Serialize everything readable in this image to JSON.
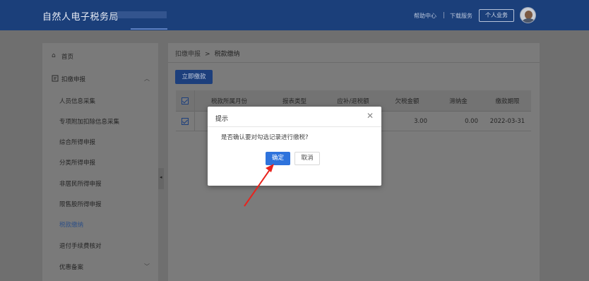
{
  "header": {
    "brand": "自然人电子税务局",
    "links": [
      "帮助中心",
      "下载服务"
    ],
    "personal_button": "个人业务"
  },
  "sidebar": {
    "items": [
      {
        "label": "首页",
        "icon": "home-icon"
      },
      {
        "label": "扣缴申报",
        "icon": "report-icon",
        "expanded": true
      },
      {
        "label": "人员信息采集"
      },
      {
        "label": "专项附加扣除信息采集"
      },
      {
        "label": "综合所得申报"
      },
      {
        "label": "分类所得申报"
      },
      {
        "label": "非居民所得申报"
      },
      {
        "label": "限售股所得申报"
      },
      {
        "label": "税款缴纳",
        "active": true
      },
      {
        "label": "退付手续费核对"
      },
      {
        "label": "优惠备案"
      }
    ]
  },
  "breadcrumb": {
    "parent": "扣缴申报",
    "separator": ">",
    "current": "税款缴纳"
  },
  "toolbar": {
    "pay_now": "立即缴款"
  },
  "table": {
    "columns": [
      "",
      "税款所属月份",
      "报表类型",
      "应补/退税额",
      "欠税金额",
      "滞纳金",
      "缴款期限"
    ],
    "rows": [
      {
        "checked": true,
        "tax_month": "",
        "report_type": "",
        "tax_due": "",
        "arrears": "3.00",
        "late_fee": "0.00",
        "deadline": "2022-03-31"
      }
    ]
  },
  "dialog": {
    "title": "提示",
    "message": "是否确认要对勾选记录进行缴税?",
    "ok": "确定",
    "cancel": "取消"
  },
  "colors": {
    "header_bg": "#1b3f7a",
    "primary": "#2e73dc",
    "annotation_arrow": "#e8231d"
  }
}
